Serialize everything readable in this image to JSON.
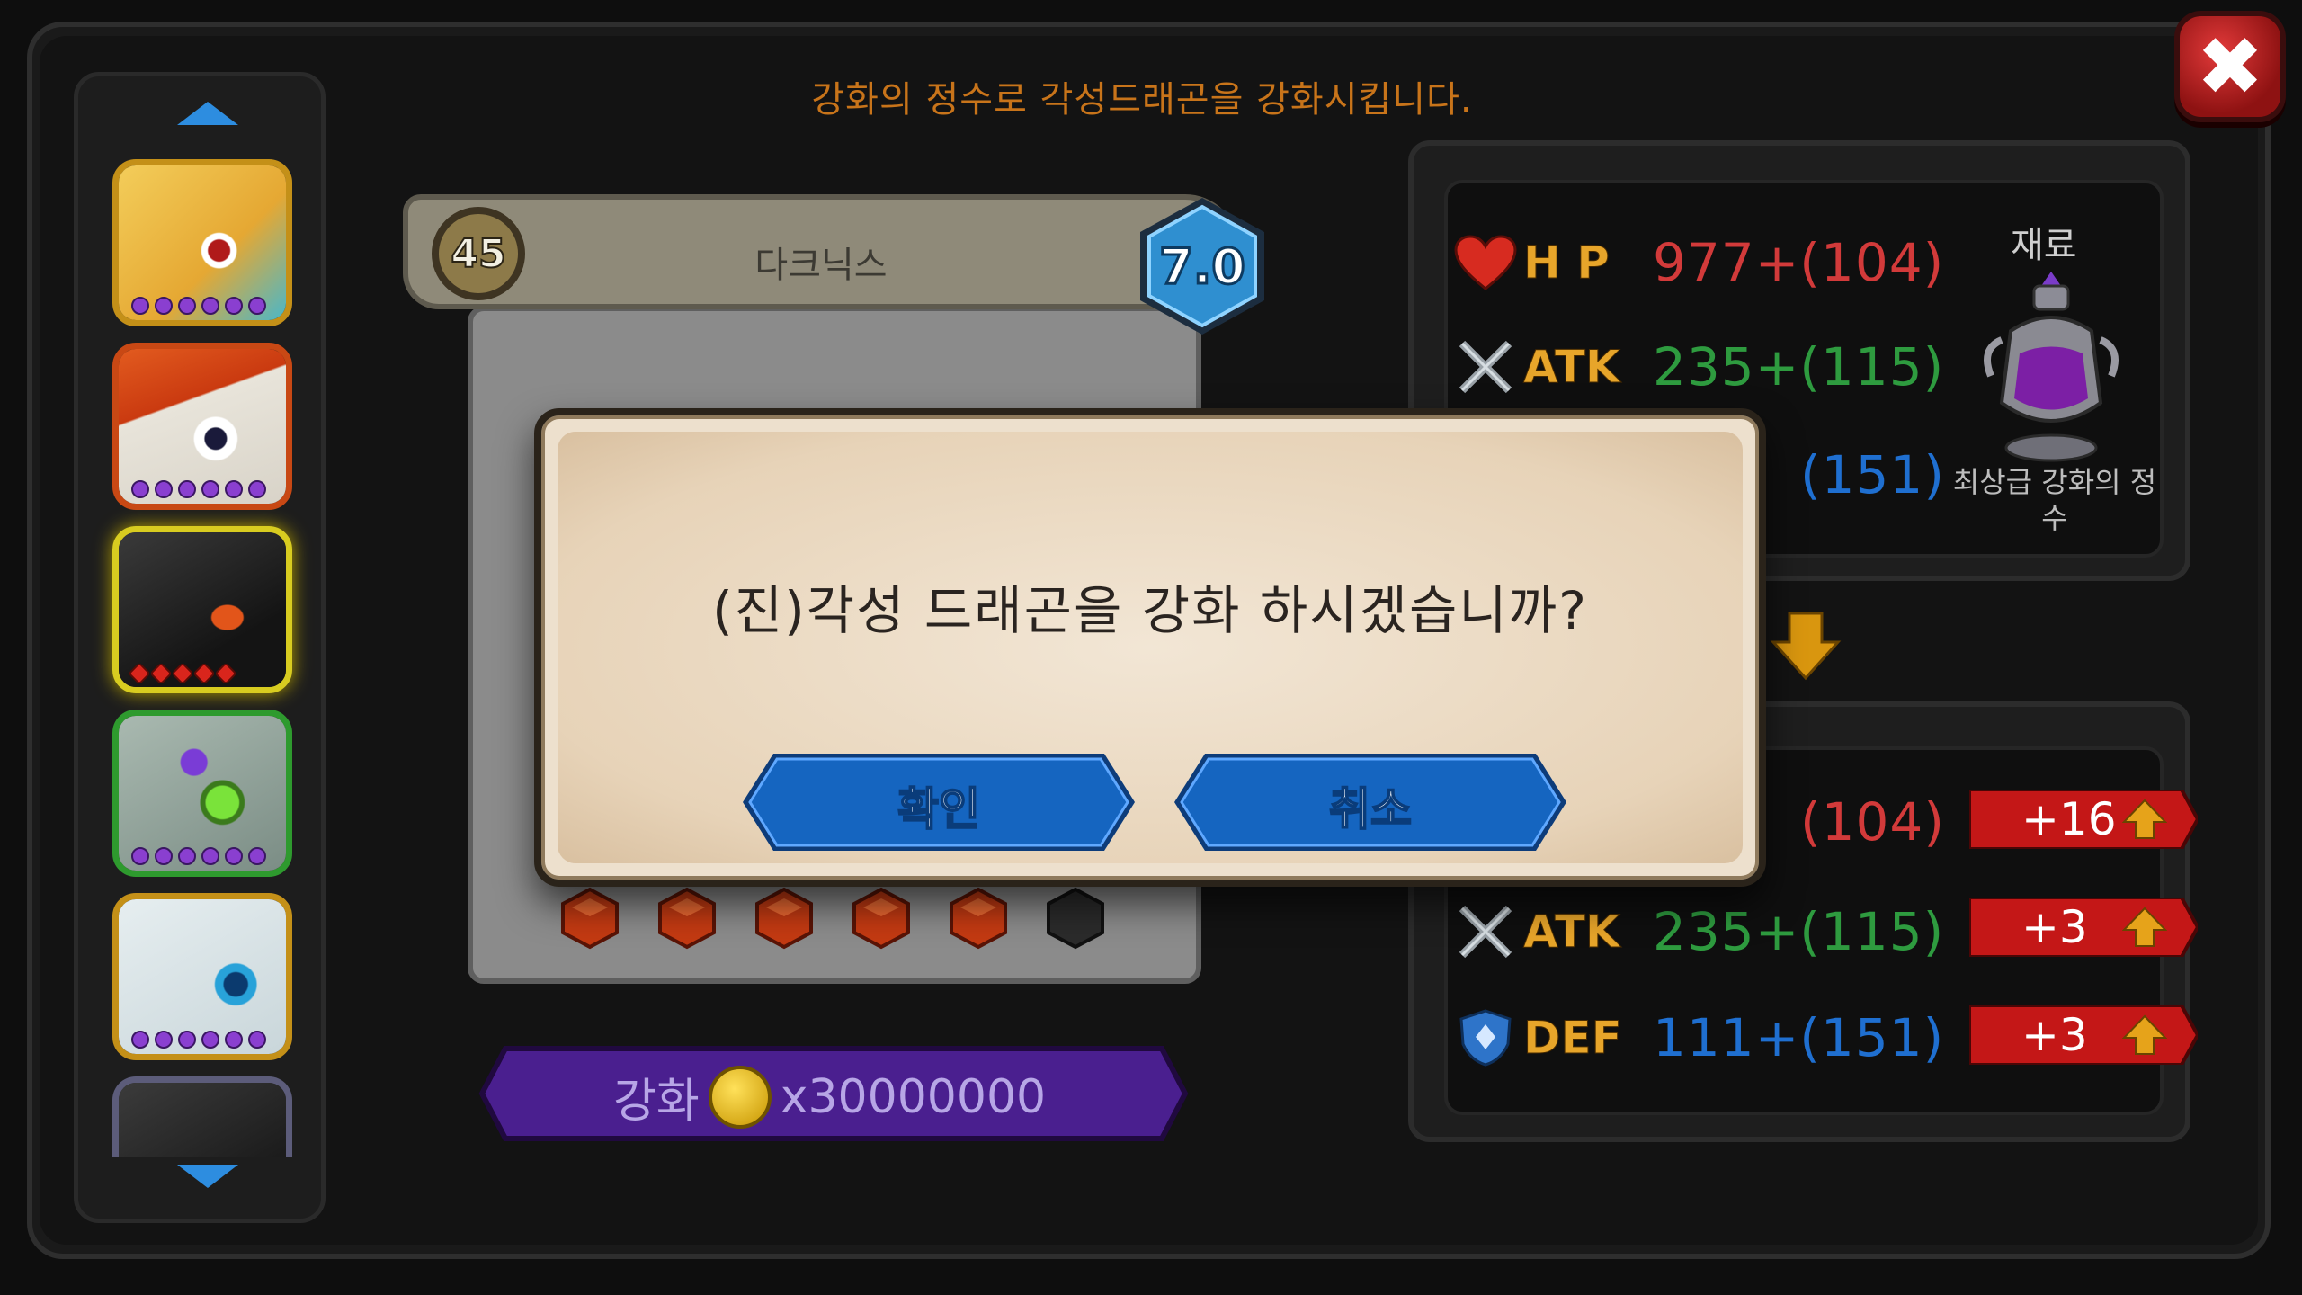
{
  "instruction": "강화의 정수로 각성드래곤을 강화시킵니다.",
  "close_label": "✖",
  "dragon": {
    "level": "45",
    "name": "다크닉스",
    "grade": "7.0",
    "enhance_label": "강화",
    "enhance_cost": "x30000000"
  },
  "gem_slots": [
    "filled",
    "filled",
    "filled",
    "filled",
    "filled",
    "empty"
  ],
  "list": {
    "items": [
      {
        "name": "dragon-yellow"
      },
      {
        "name": "dragon-red"
      },
      {
        "name": "dragon-dark",
        "selected": true
      },
      {
        "name": "dragon-green"
      },
      {
        "name": "dragon-white"
      },
      {
        "name": "dragon-partial"
      }
    ]
  },
  "current_stats": {
    "hp_label": "H P",
    "hp_value": "977+(104)",
    "atk_label": "ATK",
    "atk_value": "235+(115)",
    "def_value_partial": "(151)"
  },
  "material": {
    "title": "재료",
    "name": "최상급 강화의 정수"
  },
  "next_stats": {
    "hp_value_partial": "(104)",
    "atk_label": "ATK",
    "atk_value": "235+(115)",
    "def_label": "DEF",
    "def_value": "111+(151)",
    "bonuses": [
      "+16",
      "+3",
      "+3"
    ]
  },
  "dialog": {
    "message": "(진)각성 드래곤을 강화 하시겠습니까?",
    "confirm_label": "확인",
    "cancel_label": "취소"
  },
  "colors": {
    "hp": "#d23a3a",
    "atk": "#2e9b3f",
    "def": "#1f6fd0",
    "accent_orange": "#c8741a",
    "button_blue": "#1565c0",
    "enhance_purple": "#4a1f8f"
  }
}
